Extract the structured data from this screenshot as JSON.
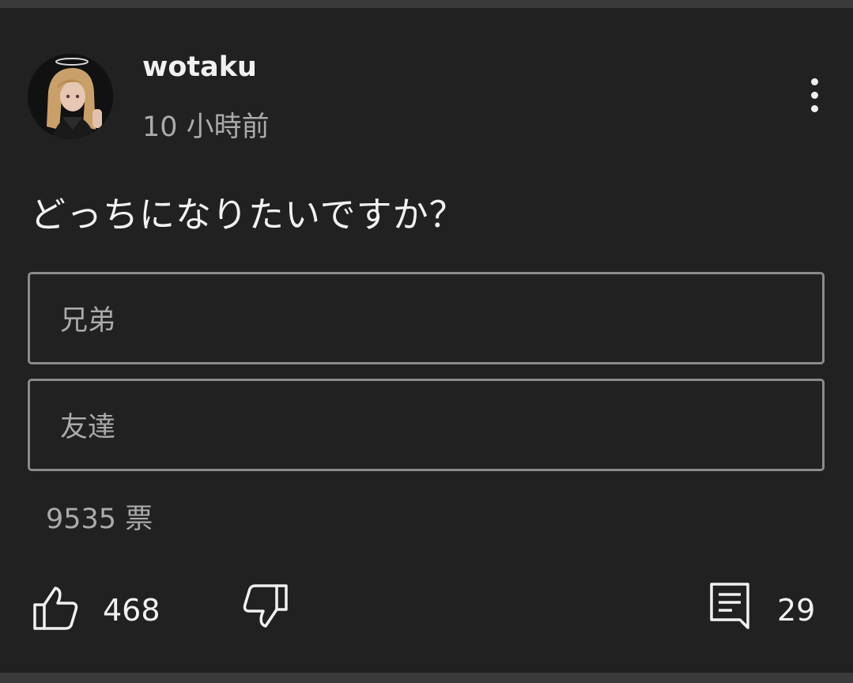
{
  "post": {
    "author": "wotaku",
    "time_ago": "10 小時前",
    "question": "どっちになりたいですか？",
    "options": [
      {
        "label": "兄弟"
      },
      {
        "label": "友達"
      }
    ],
    "vote_count": "9535 票",
    "likes": "468",
    "comments": "29"
  },
  "icons": {
    "avatar": "anime-character-avatar",
    "menu": "more-vertical-icon",
    "like": "thumbs-up-icon",
    "dislike": "thumbs-down-icon",
    "comment": "comment-icon"
  },
  "colors": {
    "background": "#212121",
    "divider": "#3a3a3a",
    "primary_text": "#f1f1f1",
    "secondary_text": "#aaaaaa",
    "option_border": "#8a8a8a"
  }
}
